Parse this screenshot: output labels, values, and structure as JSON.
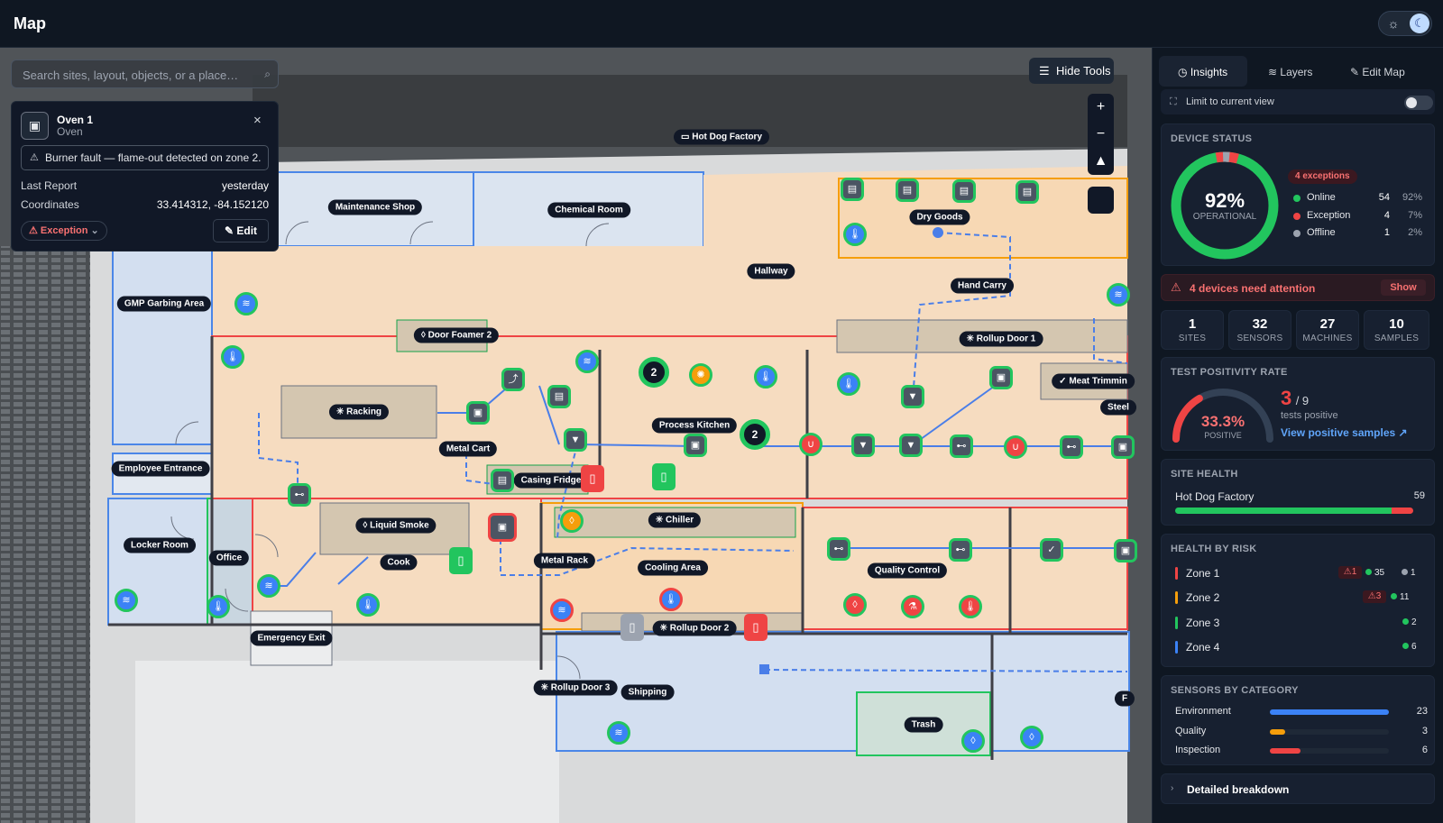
{
  "header": {
    "title": "Map",
    "theme_sun_icon": "sun-icon",
    "theme_moon_icon": "moon-icon"
  },
  "map": {
    "search": {
      "placeholder": "Search sites, layout, objects, or a place…"
    },
    "hide_tools_label": "Hide Tools",
    "zoom": {
      "in": "+",
      "out": "−",
      "north": "▲"
    },
    "labels": {
      "site": "Hot Dog Factory",
      "maintenance_shop": "Maintenance Shop",
      "chemical_room": "Chemical Room",
      "dry_goods": "Dry Goods",
      "hallway": "Hallway",
      "hand_carry": "Hand Carry",
      "gmp_garbing_area": "GMP Garbing Area",
      "door_foamer_2": "Door Foamer 2",
      "rollup_door_1": "Rollup Door 1",
      "meat_trimming": "Meat Trimmin",
      "steel": "Steel",
      "racking": "Racking",
      "process_kitchen": "Process Kitchen",
      "metal_cart": "Metal Cart",
      "employee_entrance": "Employee Entrance",
      "casing_fridge": "Casing Fridge",
      "liquid_smoke": "Liquid Smoke",
      "chiller": "Chiller",
      "locker_room": "Locker Room",
      "office": "Office",
      "cook": "Cook",
      "metal_rack": "Metal Rack",
      "cooling_area": "Cooling Area",
      "quality_control": "Quality Control",
      "rollup_door_2": "Rollup Door 2",
      "emergency_exit": "Emergency Exit",
      "rollup_door_3": "Rollup Door 3",
      "shipping": "Shipping",
      "trash": "Trash",
      "edge_f": "F"
    },
    "clusters": {
      "a": "2",
      "b": "2"
    }
  },
  "popup": {
    "name": "Oven 1",
    "type": "Oven",
    "alert": "Burner fault — flame-out detected on zone 2.",
    "last_report_label": "Last Report",
    "last_report_value": "yesterday",
    "coordinates_label": "Coordinates",
    "coordinates_value": "33.414312, -84.152120",
    "status": "Exception",
    "edit_label": "Edit"
  },
  "panel": {
    "tabs": [
      {
        "label": "Insights",
        "icon": "clock-icon",
        "active": true
      },
      {
        "label": "Layers",
        "icon": "layers-icon",
        "active": false
      },
      {
        "label": "Edit Map",
        "icon": "pencil-icon",
        "active": false
      }
    ],
    "limit_label": "Limit to current view",
    "limit_on": false,
    "device_status": {
      "title": "DEVICE STATUS",
      "percent": "92%",
      "caption": "OPERATIONAL",
      "exceptions_badge": "4 exceptions",
      "rows": [
        {
          "label": "Online",
          "count": "54",
          "pct": "92%",
          "color": "#22c55e"
        },
        {
          "label": "Exception",
          "count": "4",
          "pct": "7%",
          "color": "#ef4444"
        },
        {
          "label": "Offline",
          "count": "1",
          "pct": "2%",
          "color": "#9ca3af"
        }
      ]
    },
    "attention": {
      "text": "4 devices need attention",
      "action": "Show"
    },
    "stats": [
      {
        "value": "1",
        "label": "SITES"
      },
      {
        "value": "32",
        "label": "SENSORS"
      },
      {
        "value": "27",
        "label": "MACHINES"
      },
      {
        "value": "10",
        "label": "SAMPLES"
      }
    ],
    "positivity": {
      "title": "TEST POSITIVITY RATE",
      "percent": "33.3%",
      "caption": "POSITIVE",
      "positive": "3",
      "total": "/ 9",
      "sub": "tests positive",
      "link": "View positive samples ↗",
      "fraction": 0.333
    },
    "site_health": {
      "title": "SITE HEALTH",
      "site": "Hot Dog Factory",
      "score": "59"
    },
    "health_by_risk": {
      "title": "HEALTH BY RISK",
      "zones": [
        {
          "name": "Zone 1",
          "color": "#ef4444",
          "exc": "1",
          "ok": "35",
          "off": "1"
        },
        {
          "name": "Zone 2",
          "color": "#f59e0b",
          "exc": "3",
          "ok": "11",
          "off": ""
        },
        {
          "name": "Zone 3",
          "color": "#22c55e",
          "exc": "",
          "ok": "2",
          "off": ""
        },
        {
          "name": "Zone 4",
          "color": "#3b82f6",
          "exc": "",
          "ok": "6",
          "off": ""
        }
      ]
    },
    "sensors_by_category": {
      "title": "SENSORS BY CATEGORY",
      "rows": [
        {
          "label": "Environment",
          "value": "23",
          "color": "#3b82f6",
          "fraction": 1.0
        },
        {
          "label": "Quality",
          "value": "3",
          "color": "#f59e0b",
          "fraction": 0.13
        },
        {
          "label": "Inspection",
          "value": "6",
          "color": "#ef4444",
          "fraction": 0.26
        }
      ]
    },
    "breakdown_label": "Detailed breakdown"
  }
}
